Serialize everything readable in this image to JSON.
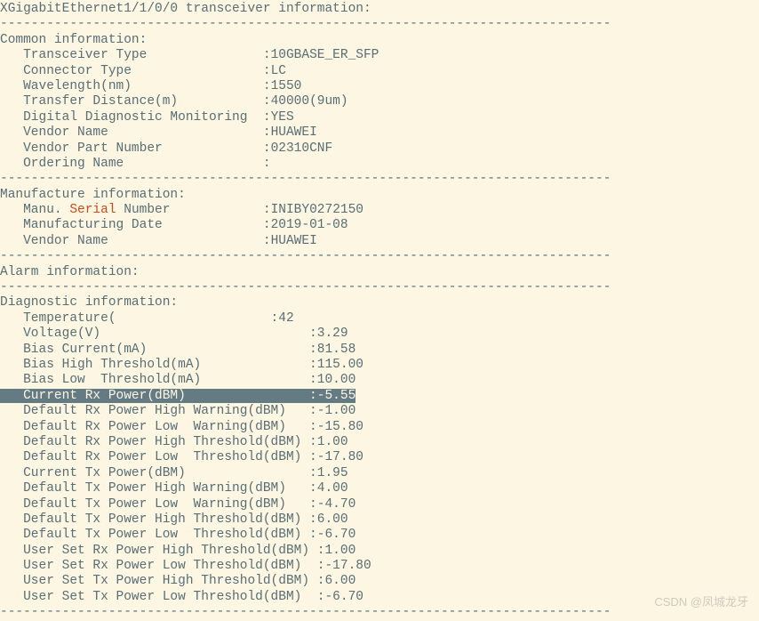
{
  "header": {
    "title": "XGigabitEthernet1/1/0/0 transceiver information:"
  },
  "sep": "-------------------------------------------------------------------------------",
  "common": {
    "header": "Common information:",
    "transceiver_type_label": "   Transceiver Type               :",
    "transceiver_type": "10GBASE_ER_SFP",
    "connector_type_label": "   Connector Type                 :",
    "connector_type": "LC",
    "wavelength_label": "   Wavelength(nm)                 :",
    "wavelength": "1550",
    "transfer_distance_label": "   Transfer Distance(m)           :",
    "transfer_distance": "40000(9um)",
    "ddm_label": "   Digital Diagnostic Monitoring  :",
    "ddm": "YES",
    "vendor_name_label": "   Vendor Name                    :",
    "vendor_name": "HUAWEI",
    "vendor_pn_label": "   Vendor Part Number             :",
    "vendor_pn": "02310CNF",
    "ordering_name_label": "   Ordering Name                  :",
    "ordering_name": ""
  },
  "manufacture": {
    "header": "Manufacture information:",
    "serial_prefix": "   Manu. ",
    "serial_word": "Serial",
    "serial_suffix": " Number            :",
    "serial": "INIBY0272150",
    "mfg_date_label": "   Manufacturing Date             :",
    "mfg_date": "2019-01-08",
    "vendor_name_label": "   Vendor Name                    :",
    "vendor_name": "HUAWEI"
  },
  "alarm": {
    "header": "Alarm information:"
  },
  "diag": {
    "header": "Diagnostic information:",
    "temp_label": "   Temperature(                    :",
    "temp": "42",
    "volt_label": "   Voltage(V)                           :",
    "volt": "3.29",
    "bias_label": "   Bias Current(mA)                     :",
    "bias": "81.58",
    "bias_hi_label": "   Bias High Threshold(mA)              :",
    "bias_hi": "115.00",
    "bias_lo_label": "   Bias Low  Threshold(mA)              :",
    "bias_lo": "10.00",
    "rx_cur_label": "   Current Rx Power(dBM)                :",
    "rx_cur": "-5.55",
    "rx_hw_label": "   Default Rx Power High Warning(dBM)   :",
    "rx_hw": "-1.00",
    "rx_lw_label": "   Default Rx Power Low  Warning(dBM)   :",
    "rx_lw": "-15.80",
    "rx_ht_label": "   Default Rx Power High Threshold(dBM) :",
    "rx_ht": "1.00",
    "rx_lt_label": "   Default Rx Power Low  Threshold(dBM) :",
    "rx_lt": "-17.80",
    "tx_cur_label": "   Current Tx Power(dBM)                :",
    "tx_cur": "1.95",
    "tx_hw_label": "   Default Tx Power High Warning(dBM)   :",
    "tx_hw": "4.00",
    "tx_lw_label": "   Default Tx Power Low  Warning(dBM)   :",
    "tx_lw": "-4.70",
    "tx_ht_label": "   Default Tx Power High Threshold(dBM) :",
    "tx_ht": "6.00",
    "tx_lt_label": "   Default Tx Power Low  Threshold(dBM) :",
    "tx_lt": "-6.70",
    "u_rx_ht_label": "   User Set Rx Power High Threshold(dBM) :",
    "u_rx_ht": "1.00",
    "u_rx_lt_label": "   User Set Rx Power Low Threshold(dBM)  :",
    "u_rx_lt": "-17.80",
    "u_tx_ht_label": "   User Set Tx Power High Threshold(dBM) :",
    "u_tx_ht": "6.00",
    "u_tx_lt_label": "   User Set Tx Power Low Threshold(dBM)  :",
    "u_tx_lt": "-6.70"
  },
  "watermark": "CSDN @凤城龙牙"
}
